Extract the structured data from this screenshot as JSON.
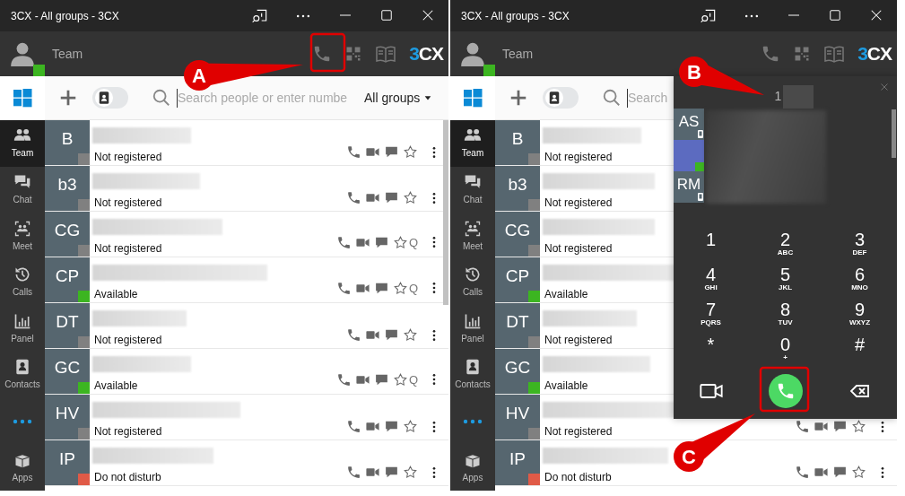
{
  "windows": [
    {
      "title": "3CX - All groups - 3CX",
      "header": {
        "title": "Team",
        "color": "#3cb521",
        "logo": "3CX"
      },
      "toolbar": {
        "contacts_only": false,
        "search_placeholder": "Search people or enter numbe",
        "group_filter": "All groups"
      },
      "sidebar": [
        {
          "kind": "item",
          "label": "Team",
          "selected": true
        },
        {
          "kind": "item",
          "label": "Chat",
          "selected": false
        },
        {
          "kind": "item",
          "label": "Meet",
          "selected": false
        },
        {
          "kind": "item",
          "label": "Calls",
          "selected": false
        },
        {
          "kind": "item",
          "label": "Panel",
          "selected": false
        },
        {
          "kind": "item",
          "label": "Contacts",
          "selected": false
        },
        {
          "kind": "more",
          "selected": false
        },
        {
          "kind": "item",
          "label": "Apps",
          "selected": false
        }
      ],
      "contacts": [
        {
          "initials": "B",
          "status": "Not registered",
          "color": "#808080"
        },
        {
          "initials": "b3",
          "status": "Not registered",
          "color": "#808080"
        },
        {
          "initials": "CG",
          "status": "Not registered",
          "color": "#808080",
          "tag": "Q"
        },
        {
          "initials": "CP",
          "status": "Available",
          "color": "#3cb521",
          "tag": "Q"
        },
        {
          "initials": "DT",
          "status": "Not registered",
          "color": "#808080"
        },
        {
          "initials": "GC",
          "status": "Available",
          "color": "#3cb521",
          "tag": "Q"
        },
        {
          "initials": "HV",
          "status": "Not registered",
          "color": "#808080"
        },
        {
          "initials": "IP",
          "status": "Do not disturb",
          "color": "#e05a47"
        }
      ]
    },
    {
      "title": "3CX - All groups - 3CX",
      "header": {
        "title": "Team",
        "color": "#3cb521",
        "logo": "3CX"
      },
      "toolbar": {
        "contacts_only": false,
        "search_placeholder": "Search"
      },
      "sidebar": [
        {
          "kind": "item",
          "label": "Team",
          "selected": true
        },
        {
          "kind": "item",
          "label": "Chat",
          "selected": false
        },
        {
          "kind": "item",
          "label": "Meet",
          "selected": false
        },
        {
          "kind": "item",
          "label": "Calls",
          "selected": false
        },
        {
          "kind": "item",
          "label": "Panel",
          "selected": false
        },
        {
          "kind": "item",
          "label": "Contacts",
          "selected": false
        },
        {
          "kind": "more",
          "selected": false
        },
        {
          "kind": "item",
          "label": "Apps",
          "selected": false
        }
      ],
      "contacts": [
        {
          "initials": "B",
          "status": "Not registered",
          "color": "#808080"
        },
        {
          "initials": "b3",
          "status": "Not registered",
          "color": "#808080"
        },
        {
          "initials": "CG",
          "status": "Not registered",
          "color": "#808080"
        },
        {
          "initials": "CP",
          "status": "Available",
          "color": "#3cb521"
        },
        {
          "initials": "DT",
          "status": "Not registered",
          "color": "#808080"
        },
        {
          "initials": "GC",
          "status": "Available",
          "color": "#3cb521"
        },
        {
          "initials": "HV",
          "status": "Not registered",
          "color": "#808080"
        },
        {
          "initials": "IP",
          "status": "Do not disturb",
          "color": "#e05a47"
        }
      ],
      "dialer": {
        "number": "1",
        "suggestions": [
          {
            "initials": "AS",
            "selected": false
          },
          {
            "selected": true,
            "color": "#3cb521"
          },
          {
            "initials": "RM",
            "selected": false
          }
        ],
        "keys": [
          {
            "digit": "1"
          },
          {
            "digit": "2",
            "letters": "ABC"
          },
          {
            "digit": "3",
            "letters": "DEF"
          },
          {
            "digit": "4",
            "letters": "GHI"
          },
          {
            "digit": "5",
            "letters": "JKL"
          },
          {
            "digit": "6",
            "letters": "MNO"
          },
          {
            "digit": "7",
            "letters": "PQRS"
          },
          {
            "digit": "8",
            "letters": "TUV"
          },
          {
            "digit": "9",
            "letters": "WXYZ"
          },
          {
            "digit": "*"
          },
          {
            "digit": "0",
            "letters": "+"
          },
          {
            "digit": "#"
          }
        ]
      }
    }
  ],
  "annotations": [
    {
      "kind": "frame"
    },
    {
      "kind": "callout",
      "label": "A"
    },
    {
      "kind": "callout",
      "label": "B"
    },
    {
      "kind": "frame"
    },
    {
      "kind": "callout",
      "label": "C"
    }
  ]
}
